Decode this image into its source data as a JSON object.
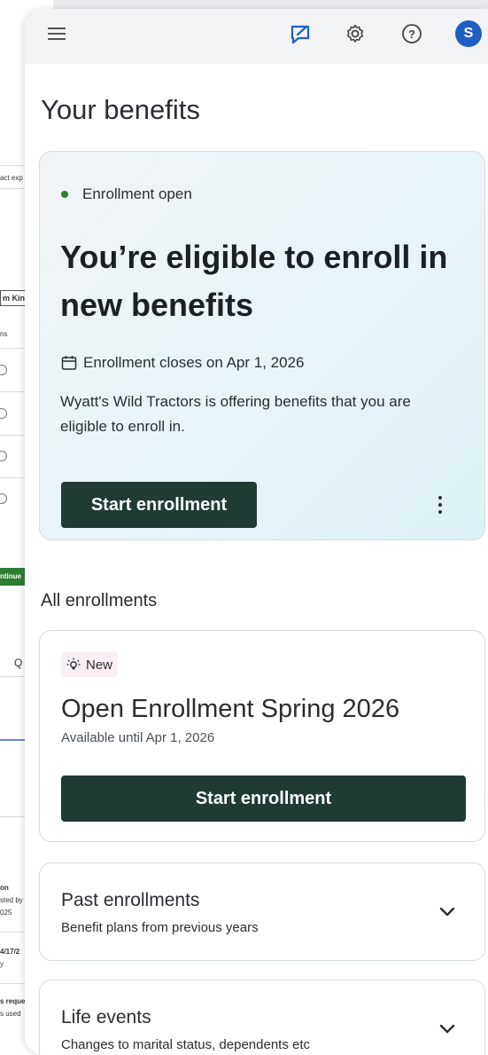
{
  "background_app": {
    "fragments": [
      "act exp",
      "m Kin",
      "ns",
      "ntinue",
      "on",
      "sted by",
      "025",
      "4/17/2",
      "y",
      "s reque",
      "s used",
      "Q"
    ]
  },
  "topbar": {
    "menu_icon": "hamburger-menu-icon",
    "feedback_icon": "feedback-icon",
    "settings_icon": "gear-icon",
    "help_icon": "help-icon",
    "avatar_initial": "S",
    "avatar_color": "#1f5fc4"
  },
  "page": {
    "title": "Your benefits"
  },
  "hero": {
    "status": "Enrollment open",
    "status_color": "#2f7d32",
    "title": "You’re eligible to enroll in new benefits",
    "closes": "Enrollment closes on Apr 1, 2026",
    "description": "Wyatt's Wild Tractors is offering benefits that you are eligible to enroll in.",
    "button_label": "Start enrollment"
  },
  "all_enrollments": {
    "heading": "All enrollments",
    "card": {
      "badge": "New",
      "title": "Open Enrollment Spring 2026",
      "subtitle": "Available until Apr 1, 2026",
      "button_label": "Start enrollment"
    }
  },
  "accordions": [
    {
      "title": "Past enrollments",
      "subtitle": "Benefit plans from previous years"
    },
    {
      "title": "Life events",
      "subtitle": "Changes to marital status, dependents etc"
    }
  ],
  "colors": {
    "primary_button": "#1e3c34",
    "badge_bg": "#fdeef3"
  }
}
